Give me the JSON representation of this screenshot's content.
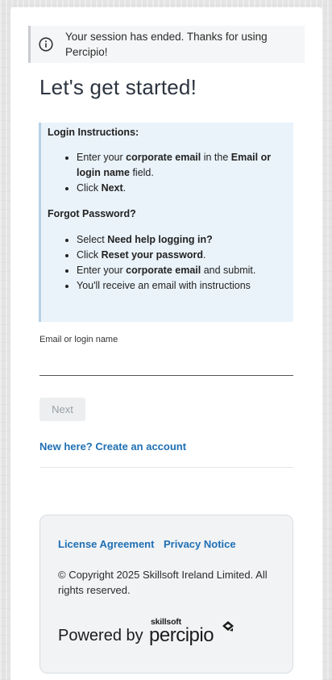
{
  "session_banner": {
    "icon": "info-icon",
    "message": "Your session has ended. Thanks for using Percipio!"
  },
  "page_title": "Let's get started!",
  "login_instructions": {
    "heading": "Login Instructions:",
    "items": [
      [
        {
          "t": "Enter your ",
          "b": false
        },
        {
          "t": "corporate email",
          "b": true
        },
        {
          "t": " in the ",
          "b": false
        },
        {
          "t": "Email or login name",
          "b": true
        },
        {
          "t": " field.",
          "b": false
        }
      ],
      [
        {
          "t": "Click ",
          "b": false
        },
        {
          "t": "Next",
          "b": true
        },
        {
          "t": ".",
          "b": false
        }
      ]
    ]
  },
  "forgot_password": {
    "heading": "Forgot Password?",
    "items": [
      [
        {
          "t": "Select ",
          "b": false
        },
        {
          "t": "Need help logging in?",
          "b": true
        }
      ],
      [
        {
          "t": "Click ",
          "b": false
        },
        {
          "t": "Reset your password",
          "b": true
        },
        {
          "t": ".",
          "b": false
        }
      ],
      [
        {
          "t": "Enter your ",
          "b": false
        },
        {
          "t": "corporate email",
          "b": true
        },
        {
          "t": " and submit.",
          "b": false
        }
      ],
      [
        {
          "t": "You'll receive an email with instructions",
          "b": false
        }
      ]
    ]
  },
  "email_field": {
    "label": "Email or login name",
    "value": ""
  },
  "next_button_label": "Next",
  "create_account_link": "New here? Create an account",
  "footer": {
    "license_link": "License Agreement",
    "privacy_link": "Privacy Notice",
    "copyright": "© Copyright 2025 Skillsoft Ireland Limited. All rights reserved.",
    "powered_by": "Powered by",
    "brand_top": "skillsoft",
    "brand_main": "percipio"
  },
  "colors": {
    "link": "#1f6fb4",
    "instructions_bg": "#eaf3fa",
    "disabled_button_bg": "#eceef0"
  }
}
